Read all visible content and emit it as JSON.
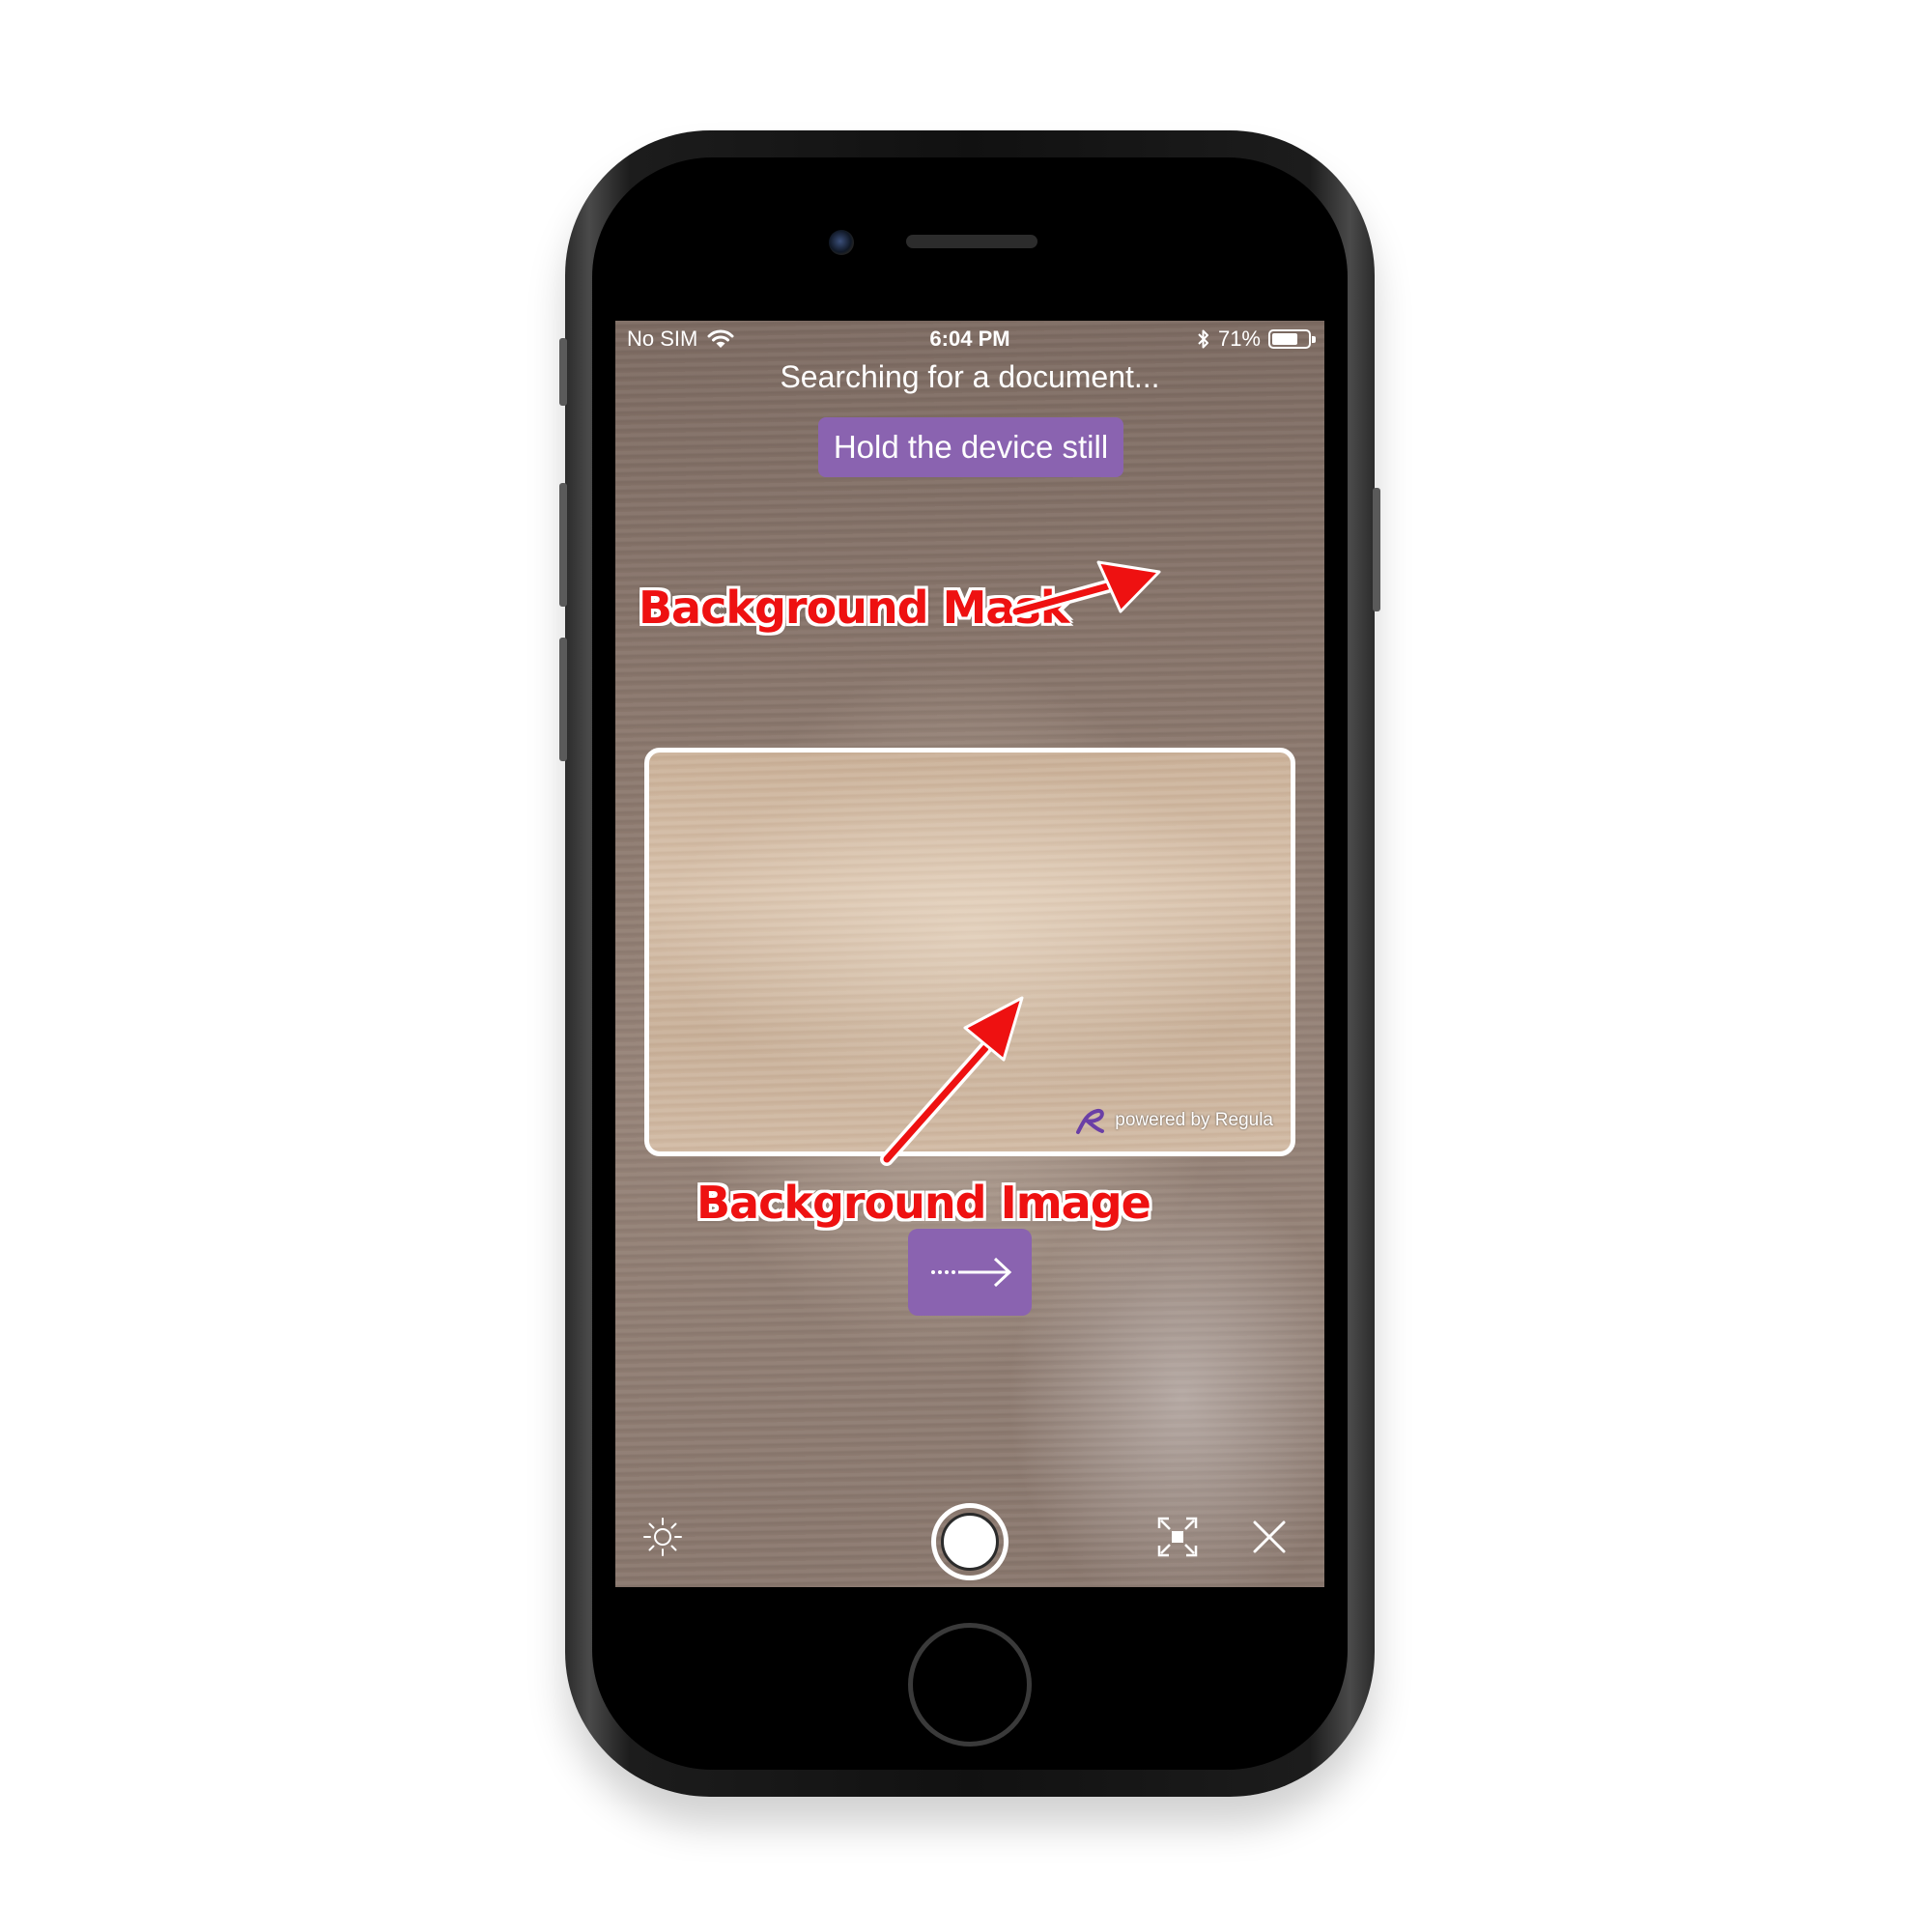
{
  "statusbar": {
    "carrier": "No SIM",
    "time": "6:04 PM",
    "battery_percent": "71%",
    "battery_level": 0.71,
    "icons": [
      "wifi-icon",
      "bluetooth-icon",
      "battery-icon"
    ]
  },
  "scanner": {
    "status_text": "Searching for a document...",
    "hint_text": "Hold the device still",
    "powered_by": "powered by Regula",
    "next_icon": "dotted-arrow-right-icon"
  },
  "controls": {
    "flash_icon": "sun-icon",
    "shutter_icon": "capture-circle-icon",
    "fullscreen_icon": "expand-frame-icon",
    "close_icon": "close-icon"
  },
  "annotations": {
    "mask_label": "Background Mask",
    "image_label": "Background Image"
  },
  "colors": {
    "accent_purple": "#8a63b0",
    "annotation_red": "#ee1111",
    "frame_border": "#ffffff"
  }
}
